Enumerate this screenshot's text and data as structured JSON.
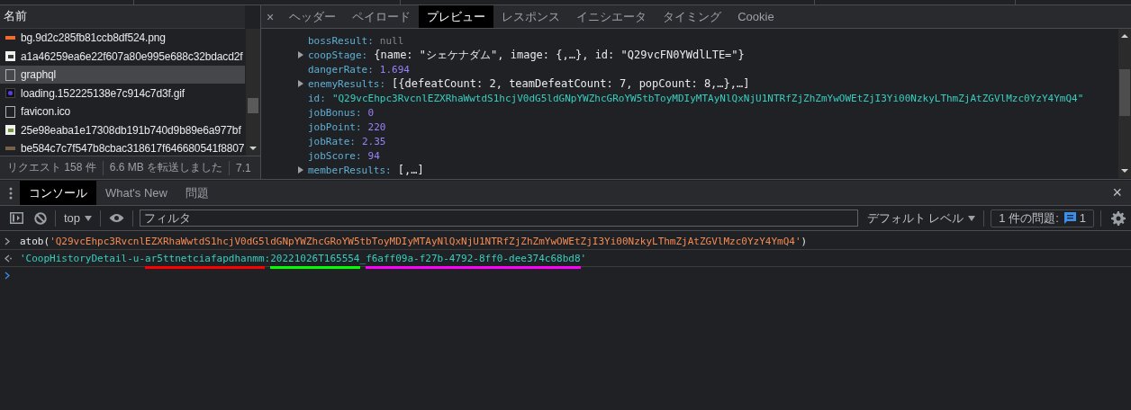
{
  "network": {
    "name_header": "名前",
    "requests": [
      {
        "name": "bg.9d2c285fb81ccb8df524.png",
        "kind": "bar-image",
        "color": "#f26a2e",
        "selected": false
      },
      {
        "name": "a1a46259ea6e22f607a80e995e688c32bdacd2f",
        "kind": "image",
        "color": "#3a3a3a",
        "selected": false
      },
      {
        "name": "graphql",
        "kind": "document",
        "selected": true
      },
      {
        "name": "loading.152225138e7c914c7d3f.gif",
        "kind": "gif",
        "color": "#5b3cf0",
        "selected": false
      },
      {
        "name": "favicon.ico",
        "kind": "document",
        "selected": false
      },
      {
        "name": "25e98eaba1e17308db191b740d9b89e6a977bf",
        "kind": "image",
        "color": "#7a9a3a",
        "selected": false
      },
      {
        "name": "be584c7c7f547b8cbac318617f646680541f8807",
        "kind": "bar-image",
        "color": "#7a6048",
        "selected": false
      }
    ],
    "summary": [
      "リクエスト 158 件",
      "6.6 MB を転送しました",
      "7.1"
    ]
  },
  "detail": {
    "close": "×",
    "tabs": [
      {
        "label": "ヘッダー",
        "selected": false
      },
      {
        "label": "ペイロード",
        "selected": false
      },
      {
        "label": "プレビュー",
        "selected": true
      },
      {
        "label": "レスポンス",
        "selected": false
      },
      {
        "label": "イニシエータ",
        "selected": false
      },
      {
        "label": "タイミング",
        "selected": false
      },
      {
        "label": "Cookie",
        "selected": false
      }
    ],
    "properties": [
      {
        "key": "bossResult:",
        "value": "null",
        "kind": "null",
        "expandable": false
      },
      {
        "key": "coopStage:",
        "value": "{name: \"シェケナダム\", image: {,…}, id: \"Q29vcFN0YWdlLTE=\"}",
        "kind": "object",
        "expandable": true
      },
      {
        "key": "dangerRate:",
        "value": "1.694",
        "kind": "number",
        "expandable": false
      },
      {
        "key": "enemyResults:",
        "value": "[{defeatCount: 2, teamDefeatCount: 7, popCount: 8,…},…]",
        "kind": "object",
        "expandable": true
      },
      {
        "key": "id:",
        "value": "\"Q29vcEhpc3RvcnlEZXRhaWwtdS1hcjV0dG5ldGNpYWZhcGRoYW5tbToyMDIyMTAyNlQxNjU1NTRfZjZhZmYwOWEtZjI3Yi00NzkyLThmZjAtZGVlMzc0YzY4YmQ4\"",
        "kind": "string",
        "expandable": false
      },
      {
        "key": "jobBonus:",
        "value": "0",
        "kind": "number",
        "expandable": false
      },
      {
        "key": "jobPoint:",
        "value": "220",
        "kind": "number",
        "expandable": false
      },
      {
        "key": "jobRate:",
        "value": "2.35",
        "kind": "number",
        "expandable": false
      },
      {
        "key": "jobScore:",
        "value": "94",
        "kind": "number",
        "expandable": false
      },
      {
        "key": "memberResults:",
        "value": "[,…]",
        "kind": "object",
        "expandable": true
      }
    ]
  },
  "drawer": {
    "tabs": [
      {
        "label": "コンソール",
        "selected": true
      },
      {
        "label": "What's New",
        "selected": false
      },
      {
        "label": "問題",
        "selected": false
      }
    ],
    "close": "×",
    "toolbar": {
      "context": "top",
      "filter_placeholder": "フィルタ",
      "level": "デフォルト レベル",
      "issues_label": "1 件の問題:",
      "issues_count": "1"
    },
    "console": {
      "input_call": "atob(",
      "input_string": "'Q29vcEhpc3RvcnlEZXRhaWwtdS1hcjV0dG5ldGNpYWZhcGRoYW5tbToyMDIyMTAyNlQxNjU1NTRfZjZhZmYwOWEtZjI3Yi00NzkyLThmZjAtZGVlMzc0YzY4YmQ4'",
      "input_close": ")",
      "result": [
        {
          "text": "'CoopHistoryDetail-u-"
        },
        {
          "text": "ar5ttnetciafapdhanmm",
          "color": "#ff0000"
        },
        {
          "text": ":"
        },
        {
          "text": "20221026T165554",
          "color": "#00ff00"
        },
        {
          "text": "_"
        },
        {
          "text": "f6aff09a-f27b-4792-8ff0-dee374c68bd8",
          "color": "#ff00ff"
        },
        {
          "text": "'"
        }
      ]
    }
  }
}
